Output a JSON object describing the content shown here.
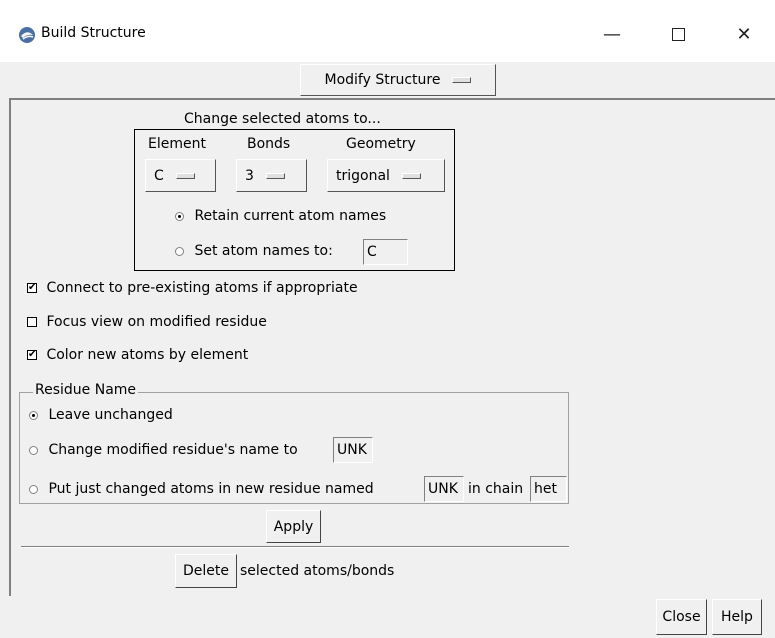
{
  "window": {
    "title": "Build Structure",
    "minimize_glyph": "—",
    "close_glyph": "✕"
  },
  "mode_menu": {
    "label": "Modify Structure"
  },
  "change": {
    "heading": "Change selected atoms to...",
    "element_label": "Element",
    "bonds_label": "Bonds",
    "geometry_label": "Geometry",
    "element_value": "C",
    "bonds_value": "3",
    "geometry_value": "trigonal",
    "retain_label": "Retain current atom names",
    "set_label": "Set atom names to:",
    "set_value": "C",
    "retain_selected": true
  },
  "options": {
    "connect_label": "Connect to pre-existing atoms if appropriate",
    "connect_checked": true,
    "focus_label": "Focus view on modified residue",
    "focus_checked": false,
    "color_label": "Color new atoms by element",
    "color_checked": true
  },
  "residue": {
    "legend": "Residue Name",
    "leave_label": "Leave unchanged",
    "change_label": "Change modified residue's name to",
    "change_value": "UNK",
    "put_label": "Put just changed atoms in new residue named",
    "put_value": "UNK",
    "chain_label": "in chain",
    "chain_value": "het",
    "selected": "leave"
  },
  "apply_label": "Apply",
  "delete": {
    "button": "Delete",
    "text": "selected atoms/bonds"
  },
  "footer": {
    "close_label": "Close",
    "help_label": "Help"
  }
}
